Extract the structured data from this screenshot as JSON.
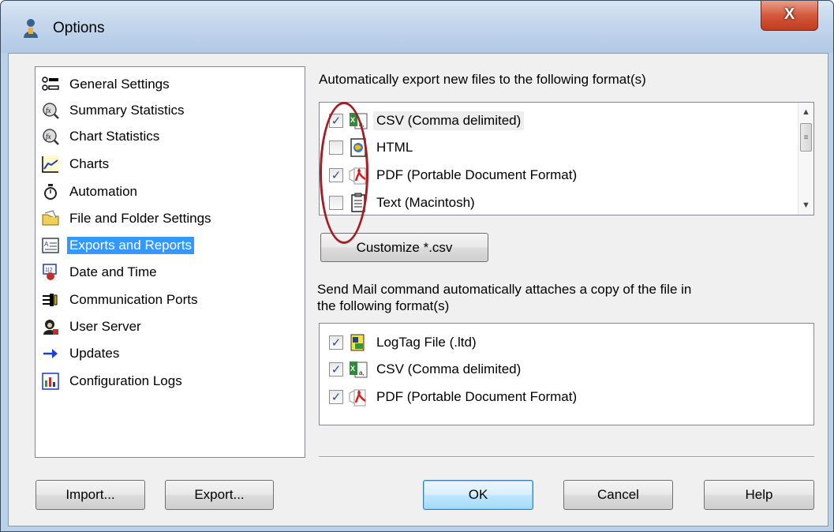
{
  "window": {
    "title": "Options",
    "close_label": "X"
  },
  "categories": [
    {
      "label": "General Settings",
      "icon": "settings-list-icon"
    },
    {
      "label": "Summary Statistics",
      "icon": "fx-magnifier-icon"
    },
    {
      "label": "Chart Statistics",
      "icon": "fx-magnifier-icon"
    },
    {
      "label": "Charts",
      "icon": "line-chart-icon"
    },
    {
      "label": "Automation",
      "icon": "stopwatch-icon"
    },
    {
      "label": "File and Folder Settings",
      "icon": "folder-icon"
    },
    {
      "label": "Exports and Reports",
      "icon": "report-icon",
      "selected": true
    },
    {
      "label": "Date and Time",
      "icon": "calendar-clock-icon"
    },
    {
      "label": "Communication Ports",
      "icon": "ports-icon"
    },
    {
      "label": "User Server",
      "icon": "user-server-icon"
    },
    {
      "label": "Updates",
      "icon": "arrow-right-icon"
    },
    {
      "label": "Configuration Logs",
      "icon": "config-log-icon"
    }
  ],
  "export_section": {
    "label": "Automatically export new files to the following format(s)",
    "formats": [
      {
        "label": "CSV (Comma delimited)",
        "checked": true,
        "icon": "csv-icon"
      },
      {
        "label": "HTML",
        "checked": false,
        "icon": "html-icon"
      },
      {
        "label": "PDF (Portable Document Format)",
        "checked": true,
        "icon": "pdf-icon"
      },
      {
        "label": "Text (Macintosh)",
        "checked": false,
        "icon": "text-file-icon"
      }
    ],
    "customize_label": "Customize *.csv"
  },
  "mail_section": {
    "label_line1": "Send Mail command automatically attaches a copy of the file in",
    "label_line2": "the following format(s)",
    "formats": [
      {
        "label": "LogTag File (.ltd)",
        "checked": true,
        "icon": "logtag-icon"
      },
      {
        "label": "CSV (Comma delimited)",
        "checked": true,
        "icon": "csv-icon"
      },
      {
        "label": "PDF (Portable Document Format)",
        "checked": true,
        "icon": "pdf-icon"
      }
    ]
  },
  "buttons": {
    "import": "Import...",
    "export": "Export...",
    "ok": "OK",
    "cancel": "Cancel",
    "help": "Help"
  },
  "check_mark": "✓",
  "colors": {
    "selection": "#3399ff",
    "annotation": "#a31f24"
  }
}
